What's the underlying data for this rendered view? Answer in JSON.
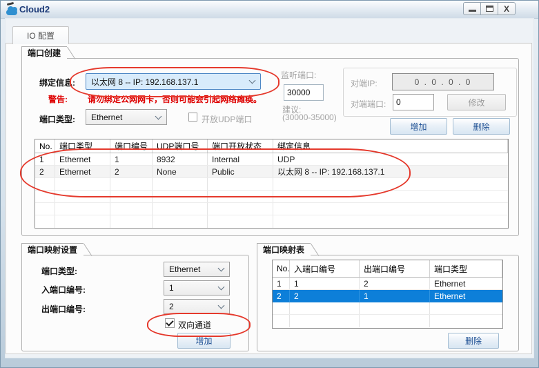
{
  "window": {
    "title": "Cloud2",
    "close_glyph": "X"
  },
  "tab": {
    "label": "IO 配置"
  },
  "port_create": {
    "title": "端口创建",
    "binding": {
      "label": "绑定信息:",
      "value": "以太网 8 -- IP: 192.168.137.1"
    },
    "warning": {
      "label": "警告:",
      "text": "请勿绑定公网网卡，否则可能会引起网络瘫痪。"
    },
    "port_type": {
      "label": "端口类型:",
      "value": "Ethernet"
    },
    "open_udp": {
      "label": "开放UDP端口",
      "checked": false
    },
    "listen_port": {
      "label": "监听端口:",
      "value": "30000"
    },
    "suggestion": {
      "label": "建议:",
      "range": "(30000-35000)"
    },
    "peer": {
      "ip_label": "对端IP:",
      "ip_value": "0 . 0 . 0 . 0",
      "port_label": "对端端口:",
      "port_value": "0",
      "modify_button": "修改"
    },
    "add_button": "增加",
    "delete_button": "删除",
    "table": {
      "headers": [
        "No.",
        "端口类型",
        "端口编号",
        "UDP端口号",
        "端口开放状态",
        "绑定信息"
      ],
      "rows": [
        [
          "1",
          "Ethernet",
          "1",
          "8932",
          "Internal",
          "UDP"
        ],
        [
          "2",
          "Ethernet",
          "2",
          "None",
          "Public",
          "以太网 8 -- IP: 192.168.137.1"
        ]
      ]
    }
  },
  "port_mapping_settings": {
    "title": "端口映射设置",
    "port_type": {
      "label": "端口类型:",
      "value": "Ethernet"
    },
    "in_port": {
      "label": "入端口编号:",
      "value": "1"
    },
    "out_port": {
      "label": "出端口编号:",
      "value": "2"
    },
    "bidirectional": {
      "label": "双向通道",
      "checked": true
    },
    "add_button": "增加"
  },
  "port_mapping_table": {
    "title": "端口映射表",
    "headers": [
      "No.",
      "入端口编号",
      "出端口编号",
      "端口类型"
    ],
    "rows": [
      [
        "1",
        "1",
        "2",
        "Ethernet"
      ],
      [
        "2",
        "2",
        "1",
        "Ethernet"
      ]
    ],
    "selected_row": 2,
    "delete_button": "删除"
  },
  "colors": {
    "selection_blue": "#0d7fd9",
    "warning_red": "#de0000",
    "annotation_red": "#e5392c",
    "button_text_blue": "#1d4f93",
    "title_text": "#1c3a77"
  }
}
